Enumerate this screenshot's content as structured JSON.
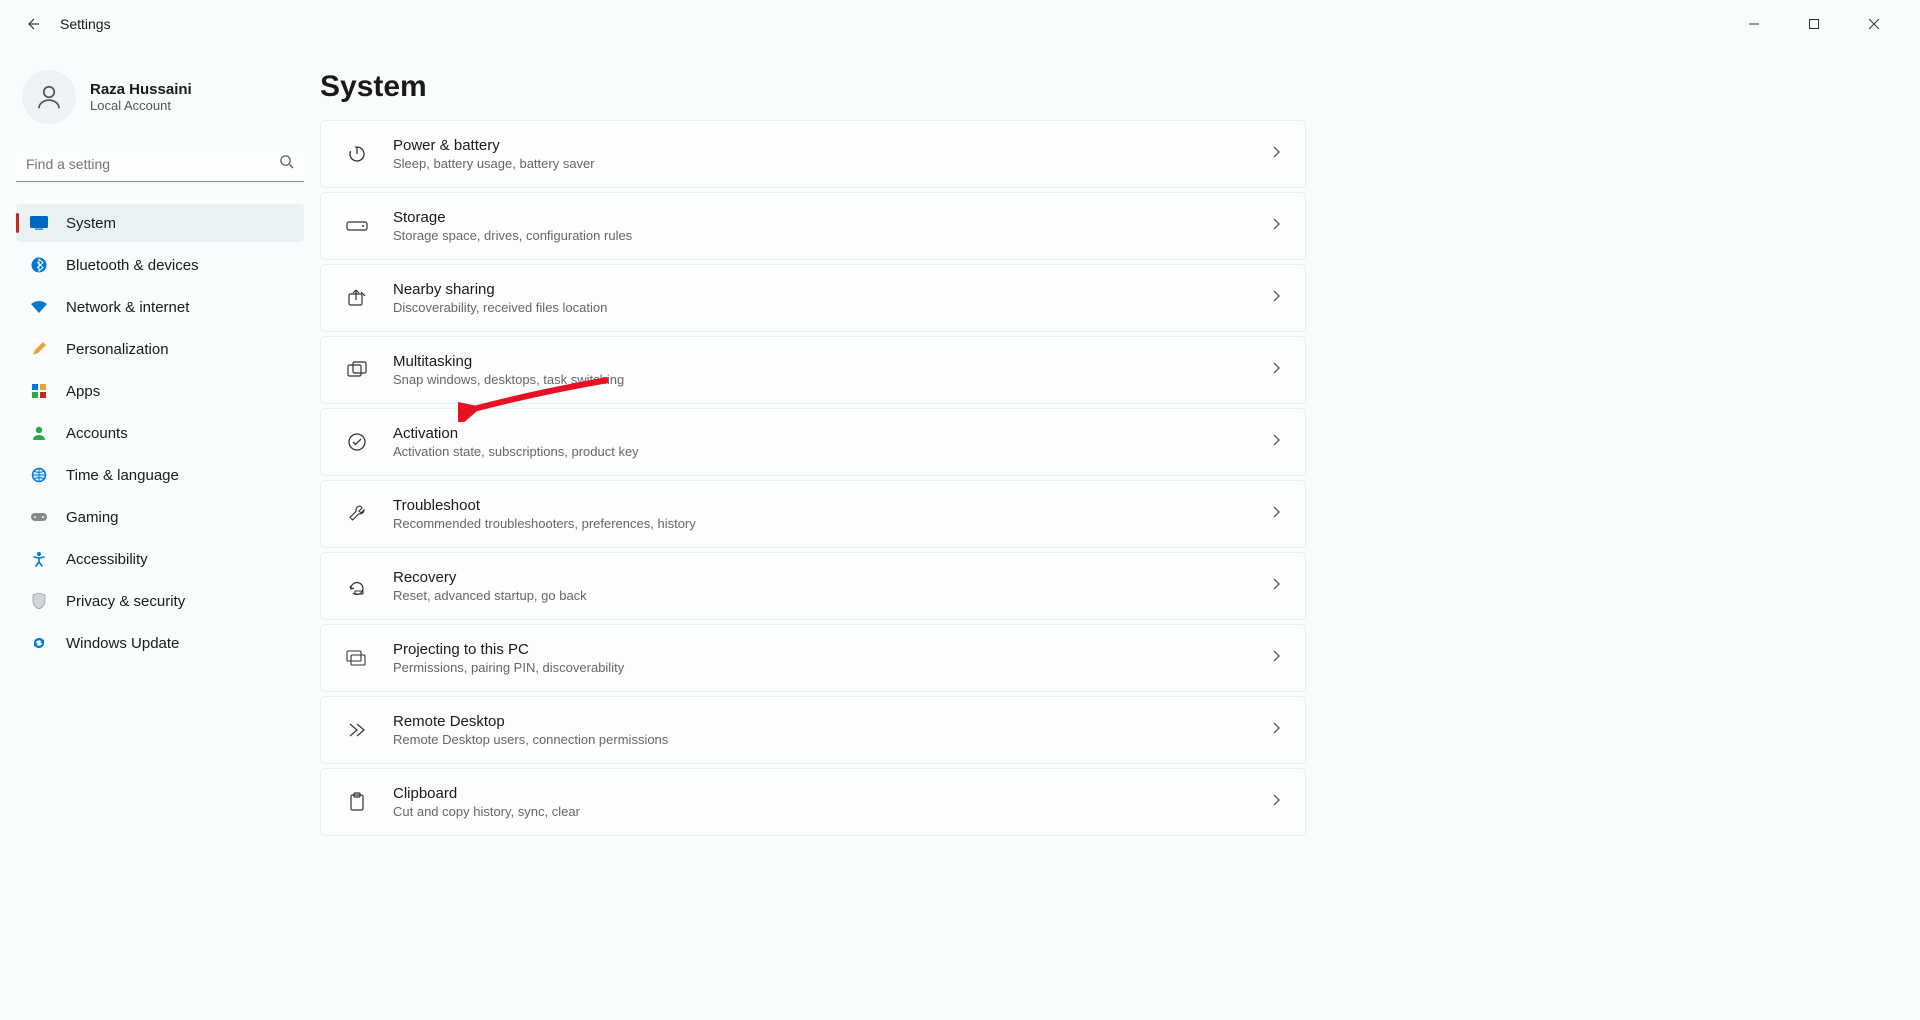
{
  "window": {
    "title": "Settings"
  },
  "profile": {
    "name": "Raza Hussaini",
    "subtitle": "Local Account"
  },
  "search": {
    "placeholder": "Find a setting"
  },
  "sidebar": {
    "items": [
      {
        "label": "System",
        "icon": "system",
        "active": true
      },
      {
        "label": "Bluetooth & devices",
        "icon": "bluetooth"
      },
      {
        "label": "Network & internet",
        "icon": "wifi"
      },
      {
        "label": "Personalization",
        "icon": "brush"
      },
      {
        "label": "Apps",
        "icon": "apps"
      },
      {
        "label": "Accounts",
        "icon": "person"
      },
      {
        "label": "Time & language",
        "icon": "globe"
      },
      {
        "label": "Gaming",
        "icon": "gamepad"
      },
      {
        "label": "Accessibility",
        "icon": "accessibility"
      },
      {
        "label": "Privacy & security",
        "icon": "shield"
      },
      {
        "label": "Windows Update",
        "icon": "update"
      }
    ]
  },
  "page": {
    "title": "System"
  },
  "cards": [
    {
      "title": "Power & battery",
      "subtitle": "Sleep, battery usage, battery saver",
      "icon": "power"
    },
    {
      "title": "Storage",
      "subtitle": "Storage space, drives, configuration rules",
      "icon": "storage"
    },
    {
      "title": "Nearby sharing",
      "subtitle": "Discoverability, received files location",
      "icon": "share"
    },
    {
      "title": "Multitasking",
      "subtitle": "Snap windows, desktops, task switching",
      "icon": "multitask"
    },
    {
      "title": "Activation",
      "subtitle": "Activation state, subscriptions, product key",
      "icon": "check-circle"
    },
    {
      "title": "Troubleshoot",
      "subtitle": "Recommended troubleshooters, preferences, history",
      "icon": "wrench"
    },
    {
      "title": "Recovery",
      "subtitle": "Reset, advanced startup, go back",
      "icon": "recovery"
    },
    {
      "title": "Projecting to this PC",
      "subtitle": "Permissions, pairing PIN, discoverability",
      "icon": "project"
    },
    {
      "title": "Remote Desktop",
      "subtitle": "Remote Desktop users, connection permissions",
      "icon": "remote"
    },
    {
      "title": "Clipboard",
      "subtitle": "Cut and copy history, sync, clear",
      "icon": "clipboard"
    }
  ],
  "annotation": {
    "arrow_target": "Activation"
  }
}
